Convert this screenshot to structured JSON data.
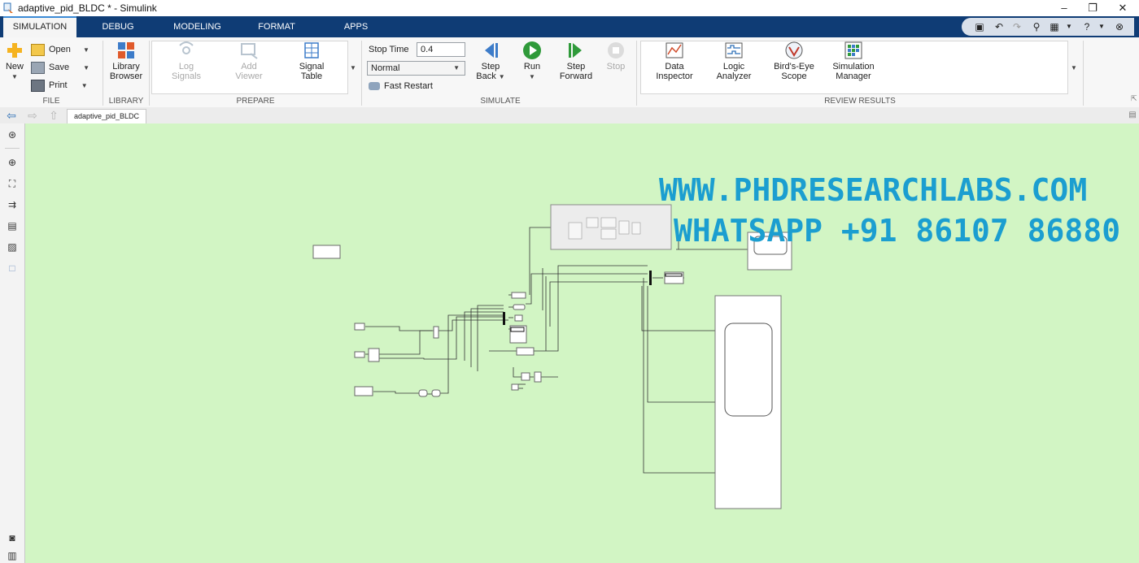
{
  "window": {
    "title": "adaptive_pid_BLDC * - Simulink",
    "minimize": "–",
    "restore": "❐",
    "close": "✕"
  },
  "tabs": [
    {
      "label": "SIMULATION",
      "active": true
    },
    {
      "label": "DEBUG"
    },
    {
      "label": "MODELING"
    },
    {
      "label": "FORMAT"
    },
    {
      "label": "APPS"
    }
  ],
  "ribbon": {
    "file": {
      "new": "New",
      "open": "Open",
      "save": "Save",
      "print": "Print",
      "group": "FILE"
    },
    "library": {
      "browser_line1": "Library",
      "browser_line2": "Browser",
      "group": "LIBRARY"
    },
    "prepare": {
      "log_line1": "Log",
      "log_line2": "Signals",
      "add_line1": "Add",
      "add_line2": "Viewer",
      "signal_line1": "Signal",
      "signal_line2": "Table",
      "group": "PREPARE"
    },
    "simulate": {
      "stop_time_label": "Stop Time",
      "stop_time_value": "0.4",
      "mode": "Normal",
      "fast_restart": "Fast Restart",
      "step_back_line1": "Step",
      "step_back_line2": "Back",
      "run": "Run",
      "step_fwd_line1": "Step",
      "step_fwd_line2": "Forward",
      "stop": "Stop",
      "group": "SIMULATE"
    },
    "review": {
      "data_line1": "Data",
      "data_line2": "Inspector",
      "logic_line1": "Logic",
      "logic_line2": "Analyzer",
      "birds_line1": "Bird's-Eye",
      "birds_line2": "Scope",
      "simmgr_line1": "Simulation",
      "simmgr_line2": "Manager",
      "group": "REVIEW RESULTS"
    }
  },
  "doc_tab": "adaptive_pid_BLDC",
  "watermark": {
    "line1": "WWW.PHDRESEARCHLABS.COM",
    "line2": "WHATSAPP +91 86107 86880"
  },
  "colors": {
    "tabbar": "#0f3c75",
    "canvas": "#d2f5c4",
    "watermark": "#1b9ed0"
  }
}
